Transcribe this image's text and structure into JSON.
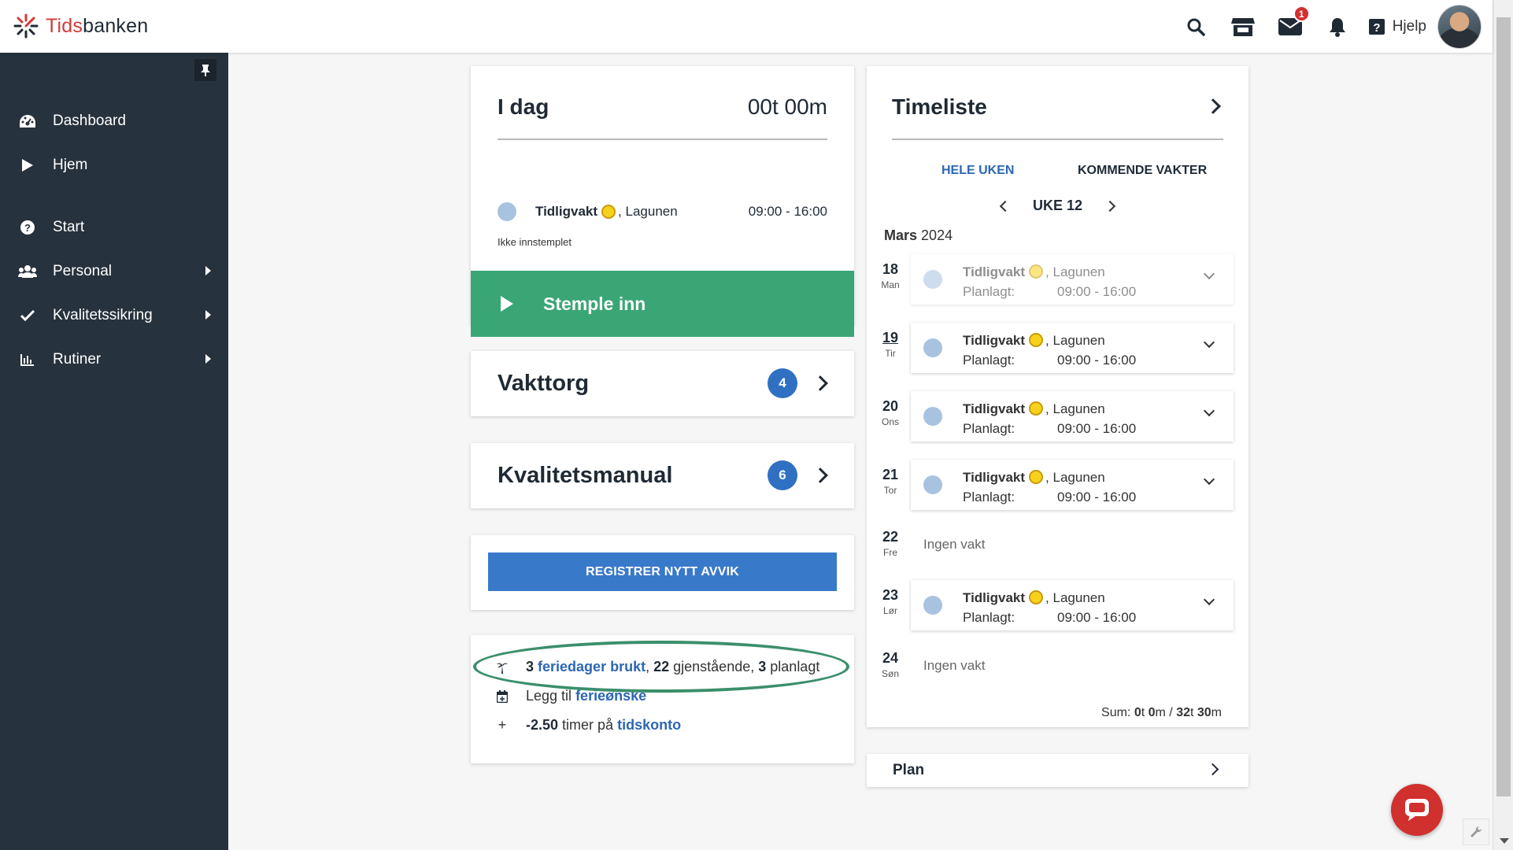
{
  "app": {
    "logo_prefix": "Tids",
    "logo_suffix": "banken"
  },
  "topbar": {
    "mail_badge": "1",
    "help_label": "Hjelp"
  },
  "sidebar": {
    "items": [
      {
        "label": "Dashboard",
        "icon": "gauge-icon"
      },
      {
        "label": "Hjem",
        "icon": "play-icon"
      },
      {
        "label": "Start",
        "icon": "question-circle-icon"
      },
      {
        "label": "Personal",
        "icon": "users-icon",
        "has_submenu": true
      },
      {
        "label": "Kvalitetssikring",
        "icon": "check-icon",
        "has_submenu": true
      },
      {
        "label": "Rutiner",
        "icon": "bar-chart-icon",
        "has_submenu": true
      }
    ]
  },
  "today": {
    "title": "I dag",
    "total": "00t 00m",
    "shift_name": "Tidligvakt",
    "shift_location": "Lagunen",
    "shift_time": "09:00 - 16:00",
    "status": "Ikke innstemplet",
    "stamp_label": "Stemple inn"
  },
  "vakttorg": {
    "title": "Vakttorg",
    "count": "4"
  },
  "kvalitetsmanual": {
    "title": "Kvalitetsmanual",
    "count": "6"
  },
  "avvik": {
    "button_label": "REGISTRER NYTT AVVIK"
  },
  "vacation": {
    "used_count": "3",
    "used_label": "feriedager brukt",
    "remaining_count": "22",
    "remaining_label": "gjenstående,",
    "planned_count": "3",
    "planned_label": "planlagt",
    "wish_prefix": "Legg til",
    "wish_link": "ferieønske",
    "hours_value": "-2.50",
    "hours_text": "timer på",
    "hours_link": "tidskonto"
  },
  "timeliste": {
    "title": "Timeliste",
    "tabs": [
      "HELE UKEN",
      "KOMMENDE VAKTER"
    ],
    "week_label": "UKE 12",
    "month_name": "Mars",
    "year": "2024",
    "planned_label": "Planlagt:",
    "days": [
      {
        "num": "18",
        "name": "Man",
        "shift": "Tidligvakt",
        "location": "Lagunen",
        "time": "09:00 - 16:00",
        "past": true
      },
      {
        "num": "19",
        "name": "Tir",
        "shift": "Tidligvakt",
        "location": "Lagunen",
        "time": "09:00 - 16:00",
        "today": true
      },
      {
        "num": "20",
        "name": "Ons",
        "shift": "Tidligvakt",
        "location": "Lagunen",
        "time": "09:00 - 16:00"
      },
      {
        "num": "21",
        "name": "Tor",
        "shift": "Tidligvakt",
        "location": "Lagunen",
        "time": "09:00 - 16:00"
      },
      {
        "num": "22",
        "name": "Fre",
        "none_label": "Ingen vakt"
      },
      {
        "num": "23",
        "name": "Lør",
        "shift": "Tidligvakt",
        "location": "Lagunen",
        "time": "09:00 - 16:00"
      },
      {
        "num": "24",
        "name": "Søn",
        "none_label": "Ingen vakt"
      }
    ],
    "sum_label": "Sum:",
    "sum_worked_h": "0",
    "sum_worked_m": "0",
    "sum_total_h": "32",
    "sum_total_m": "30"
  },
  "plan": {
    "title": "Plan"
  },
  "colors": {
    "sidebar": "#26323d",
    "accent_green": "#3aa675",
    "accent_blue": "#3979c9",
    "badge_blue": "#2f70c2",
    "link": "#2b67b3",
    "chat": "#d0302e"
  }
}
